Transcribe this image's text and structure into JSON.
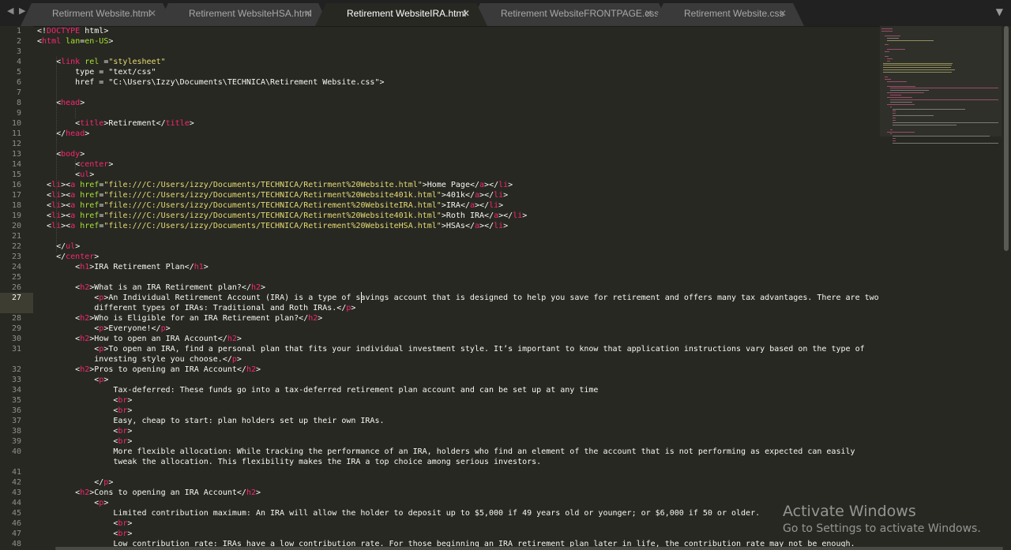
{
  "tabs": [
    {
      "label": "Retirment Website.html",
      "close": "✕",
      "active": false
    },
    {
      "label": "Retirement WebsiteHSA.html",
      "close": "✕",
      "active": false
    },
    {
      "label": "Retirement WebsiteIRA.html",
      "close": "✕",
      "active": true
    },
    {
      "label": "Retirement WebsiteFRONTPAGE.css",
      "close": "✕",
      "active": false
    },
    {
      "label": "Retirement Website.css",
      "close": "✕",
      "active": false
    }
  ],
  "nav": {
    "back_icon": "◀",
    "forward_icon": "▶",
    "menu_icon": "▼"
  },
  "editor": {
    "current_line": 27,
    "lines": [
      {
        "n": "1",
        "text": "<!DOCTYPE html>"
      },
      {
        "n": "2",
        "text": "<html lan=en-US>"
      },
      {
        "n": "3",
        "text": ""
      },
      {
        "n": "4",
        "text": "    <link rel =\"stylesheet\""
      },
      {
        "n": "5",
        "text": "        type = \"text/css\""
      },
      {
        "n": "6",
        "text": "        href = \"C:\\Users\\Izzy\\Documents\\TECHNICA\\Retirement Website.css\">"
      },
      {
        "n": "7",
        "text": ""
      },
      {
        "n": "8",
        "text": "    <head>"
      },
      {
        "n": "9",
        "text": ""
      },
      {
        "n": "10",
        "text": "        <title>Retirement</title>"
      },
      {
        "n": "11",
        "text": "    </head>"
      },
      {
        "n": "12",
        "text": ""
      },
      {
        "n": "13",
        "text": "    <body>"
      },
      {
        "n": "14",
        "text": "        <center>"
      },
      {
        "n": "15",
        "text": "        <ul>"
      },
      {
        "n": "16",
        "text": "  <li><a href=\"file:///C:/Users/izzy/Documents/TECHNICA/Retirment%20Website.html\">Home Page</a></li>"
      },
      {
        "n": "17",
        "text": "  <li><a href=\"file:///C:/Users/izzy/Documents/TECHNICA/Retirment%20Website401k.html\">401k</a></li>"
      },
      {
        "n": "18",
        "text": "  <li><a href=\"file:///C:/Users/izzy/Documents/TECHNICA/Retirement%20WebsiteIRA.html\">IRA</a></li>"
      },
      {
        "n": "19",
        "text": "  <li><a href=\"file:///C:/Users/izzy/Documents/TECHNICA/Retirment%20Website401k.html\">Roth IRA</a></li>"
      },
      {
        "n": "20",
        "text": "  <li><a href=\"file:///C:/Users/izzy/Documents/TECHNICA/Retirement%20WebsiteHSA.html\">HSAs</a></li>"
      },
      {
        "n": "21",
        "text": ""
      },
      {
        "n": "22",
        "text": "    </ul>"
      },
      {
        "n": "23",
        "text": "    </center>"
      },
      {
        "n": "24",
        "text": "        <h1>IRA Retirement Plan</h1>"
      },
      {
        "n": "25",
        "text": ""
      },
      {
        "n": "26",
        "text": "        <h2>What is an IRA Retirement plan?</h2>"
      },
      {
        "n": "27",
        "text": "            <p>An Individual Retirement Account (IRA) is a type of savings account that is designed to help you save for retirement and offers many tax advantages. There are two"
      },
      {
        "n": "",
        "text": "            different types of IRAs: Traditional and Roth IRAs.</p>"
      },
      {
        "n": "28",
        "text": "        <h2>Who is Eligible for an IRA Retirement plan?</h2>"
      },
      {
        "n": "29",
        "text": "            <p>Everyone!</p>"
      },
      {
        "n": "30",
        "text": "        <h2>How to open an IRA Account</h2>"
      },
      {
        "n": "31",
        "text": "            <p>To open an IRA, find a personal plan that fits your individual investment style. It’s important to know that application instructions vary based on the type of"
      },
      {
        "n": "",
        "text": "            investing style you choose.</p>"
      },
      {
        "n": "32",
        "text": "        <h2>Pros to opening an IRA Account</h2>"
      },
      {
        "n": "33",
        "text": "            <p>"
      },
      {
        "n": "34",
        "text": "                Tax-deferred: These funds go into a tax-deferred retirement plan account and can be set up at any time"
      },
      {
        "n": "35",
        "text": "                <br>"
      },
      {
        "n": "36",
        "text": "                <br>"
      },
      {
        "n": "37",
        "text": "                Easy, cheap to start: plan holders set up their own IRAs."
      },
      {
        "n": "38",
        "text": "                <br>"
      },
      {
        "n": "39",
        "text": "                <br>"
      },
      {
        "n": "40",
        "text": "                More flexible allocation: While tracking the performance of an IRA, holders who find an element of the account that is not performing as expected can easily"
      },
      {
        "n": "",
        "text": "                tweak the allocation. This flexibility makes the IRA a top choice among serious investors."
      },
      {
        "n": "41",
        "text": ""
      },
      {
        "n": "42",
        "text": "            </p>"
      },
      {
        "n": "43",
        "text": "        <h2>Cons to opening an IRA Account</h2>"
      },
      {
        "n": "44",
        "text": "            <p>"
      },
      {
        "n": "45",
        "text": "                Limited contribution maximum: An IRA will allow the holder to deposit up to $5,000 if 49 years old or younger; or $6,000 if 50 or older."
      },
      {
        "n": "46",
        "text": "                <br>"
      },
      {
        "n": "47",
        "text": "                <br>"
      },
      {
        "n": "48",
        "text": "                Low contribution rate: IRAs have a low contribution rate. For those beginning an IRA retirement plan later in life, the contribution rate may not be enough."
      }
    ]
  },
  "watermark": {
    "title": "Activate Windows",
    "subtitle": "Go to Settings to activate Windows."
  }
}
